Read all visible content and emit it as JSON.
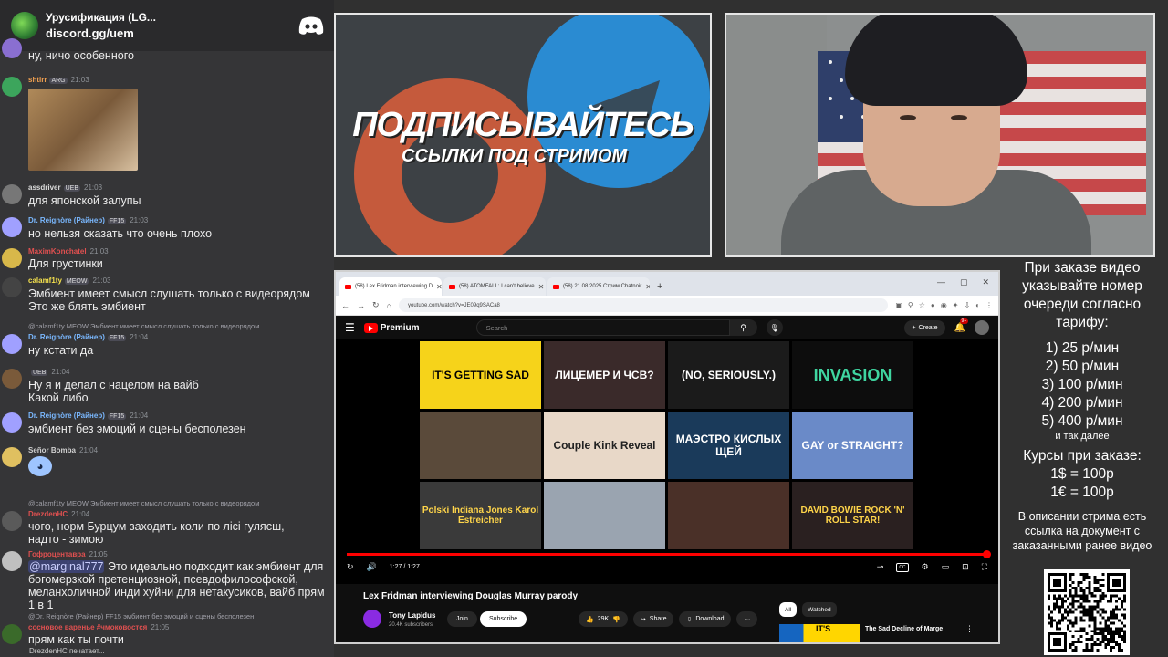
{
  "chat": {
    "server_name": "Урусификация (LG...",
    "server_link": "discord.gg/uem",
    "messages": [
      {
        "author": "",
        "badge": "",
        "time": "",
        "text": "ну, ничо особенного",
        "author_color": "#ffffff",
        "reply": ""
      },
      {
        "author": "shtirr",
        "badge": "ARG",
        "time": "21:03",
        "text": "",
        "author_color": "#f0a050",
        "reply": "",
        "has_image": true
      },
      {
        "author": "assdriver",
        "badge": "UEB",
        "time": "21:03",
        "text": "для японской залупы",
        "author_color": "#dcdcdc",
        "reply": ""
      },
      {
        "author": "Dr. Reignòre (Райнер)",
        "badge": "FF15",
        "time": "21:03",
        "text": "но нельзя сказать что очень плохо",
        "author_color": "#7ab8ff",
        "reply": ""
      },
      {
        "author": "MaximKonchatel",
        "badge": "",
        "time": "21:03",
        "text": "Для грустинки",
        "author_color": "#e05050",
        "reply": ""
      },
      {
        "author": "calamf1ty",
        "badge": "MEOW",
        "time": "21:03",
        "text": "Эмбиент имеет смысл слушать только с видеорядом\nЭто же блять эмбиент",
        "author_color": "#f4e04d",
        "reply": ""
      },
      {
        "author": "Dr. Reignòre (Райнер)",
        "badge": "FF15",
        "time": "21:04",
        "text": "ну кстати да",
        "author_color": "#7ab8ff",
        "reply": "@calamf1ty MEOW Эмбиент имеет смысл слушать только с видеорядом"
      },
      {
        "author": "",
        "badge": "UEB",
        "time": "21:04",
        "text": "Ну я и делал с нацелом на вайб\nКакой либо",
        "author_color": "#dcdcdc",
        "reply": ""
      },
      {
        "author": "Dr. Reignòre (Райнер)",
        "badge": "FF15",
        "time": "21:04",
        "text": "эмбиент без эмоций и сцены бесполезен",
        "author_color": "#7ab8ff",
        "reply": ""
      },
      {
        "author": "Señor Bomba",
        "badge": "",
        "time": "21:04",
        "text": "",
        "author_color": "#d0d0d0",
        "reply": "",
        "has_emote": true
      },
      {
        "author": "DrezdenHC",
        "badge": "",
        "time": "21:04",
        "text": "чого, норм Бурцум заходить коли по лісі гуляєш,\nнадто - зимою",
        "author_color": "#e05050",
        "reply": "@calamf1ty MEOW Эмбиент имеет смысл слушать только с видеорядом"
      },
      {
        "author": "Гофроцентавра",
        "badge": "",
        "time": "21:05",
        "text": "Это идеально подходит как эмбиент для богомерзкой претенциозной, псевдофилософской, меланхоличной инди хуйни для нетакусиков, вайб прям 1 в 1",
        "author_color": "#e05050",
        "reply": "",
        "mention": "@marginal777"
      },
      {
        "author": "сосновое варенье #чмоковостся",
        "badge": "",
        "time": "21:05",
        "text": "прям как ты почти",
        "author_color": "#e05050",
        "reply": "@Dr. Reignòre (Райнер) FF15 эмбиент без эмоций и сцены бесполезен"
      }
    ],
    "typing": "DrezdenHC печатает..."
  },
  "promo": {
    "title": "ПОДПИСЫВАЙТЕСЬ",
    "subtitle": "ССЫЛКИ ПОД СТРИМОМ"
  },
  "browser": {
    "tabs": [
      {
        "label": "(58) Lex Fridman interviewing D",
        "active": true
      },
      {
        "label": "(58) ATOMFALL: I can't believe",
        "active": false
      },
      {
        "label": "(58) 21.08.2025 Стрим Chatnoir",
        "active": false
      }
    ],
    "url": "youtube.com/watch?v=JE09q9SACa8"
  },
  "youtube": {
    "logo_label": "Premium",
    "search_placeholder": "Search",
    "create_label": "Create",
    "notif_count": "9+",
    "thumbnails": [
      {
        "text": "IT'S GETTING SAD",
        "bg": "#f6d31a",
        "fg": "#000000"
      },
      {
        "text": "ЛИЦЕМЕР И ЧСВ?",
        "bg": "#3a2a2a",
        "fg": "#ffffff"
      },
      {
        "text": "(NO, SERIOUSLY.)",
        "bg": "#1b1b1b",
        "fg": "#ffffff"
      },
      {
        "text": "INVASION",
        "bg": "#0d0d0d",
        "fg": "#3fd5a0"
      },
      {
        "text": "",
        "bg": "#5a4a3a",
        "fg": "#ffffff"
      },
      {
        "text": "Couple Kink Reveal",
        "bg": "#e8d8c8",
        "fg": "#222222"
      },
      {
        "text": "МАЭСТРО КИСЛЫХ ЩЕЙ",
        "bg": "#1a3a5a",
        "fg": "#ffffff"
      },
      {
        "text": "GAY or STRAIGHT?",
        "bg": "#6a8ac8",
        "fg": "#ffffff"
      },
      {
        "text": "Polski Indiana Jones Karol Estreicher",
        "bg": "#3a3a3a",
        "fg": "#ffd54a"
      },
      {
        "text": "",
        "bg": "#9aa4b0",
        "fg": "#ffffff"
      },
      {
        "text": "",
        "bg": "#4a3028",
        "fg": "#ffffff"
      },
      {
        "text": "DAVID BOWIE ROCK 'N' ROLL STAR!",
        "bg": "#2a2020",
        "fg": "#ffd54a"
      }
    ],
    "time_display": "1:27 / 1:27",
    "progress_fraction": 1.0,
    "video_title": "Lex Fridman interviewing Douglas Murray parody",
    "channel_name": "Tony Lapidus",
    "channel_subs": "20.4K subscribers",
    "join_label": "Join",
    "subscribe_label": "Subscribe",
    "like_count": "29K",
    "share_label": "Share",
    "download_label": "Download",
    "chips": [
      "All",
      "Watched"
    ],
    "rec_thumb_text": "IT'S",
    "rec_title": "The Sad Decline of Marge"
  },
  "info": {
    "lead": "При заказе видео указывайте номер очереди согласно тарифу:",
    "tariffs": [
      "1) 25 р/мин",
      "2) 50 р/мин",
      "3) 100 р/мин",
      "4) 200 р/мин",
      "5) 400 р/мин"
    ],
    "etc": "и так далее",
    "rates_title": "Курсы при заказе:",
    "rates": [
      "1$ = 100р",
      "1€ = 100р"
    ],
    "desc": "В описании стрима есть ссылка на документ с заказанными ранее видео"
  }
}
